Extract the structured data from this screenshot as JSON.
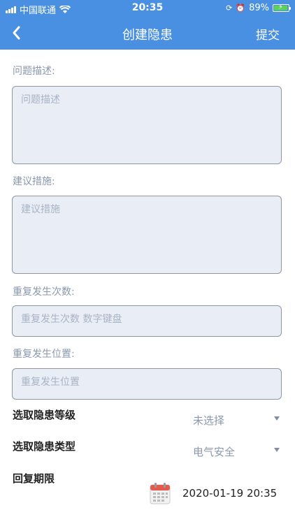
{
  "status": {
    "carrier": "中国联通",
    "time": "20:35",
    "battery": "89%",
    "battery_level": 0.89
  },
  "nav": {
    "back_icon": "chevron-left-icon",
    "title": "创建隐患",
    "submit": "提交"
  },
  "fields": {
    "problem_description": {
      "label": "问题描述:",
      "placeholder": "问题描述"
    },
    "suggested_measures": {
      "label": "建议措施:",
      "placeholder": "建议措施"
    },
    "repeat_count": {
      "label": "重复发生次数:",
      "placeholder": "重复发生次数 数字键盘"
    },
    "repeat_location": {
      "label": "重复发生位置:",
      "placeholder": "重复发生位置"
    }
  },
  "selects": {
    "level": {
      "label": "选取隐患等级",
      "value": "未选择"
    },
    "type": {
      "label": "选取隐患类型",
      "value": "电气安全"
    }
  },
  "deadline": {
    "label": "回复期限",
    "value": "2020-01-19 20:35",
    "icon": "calendar-icon"
  },
  "colors": {
    "accent": "#4a90e2",
    "field_bg": "#e9eef6",
    "label": "#8a97ad"
  }
}
